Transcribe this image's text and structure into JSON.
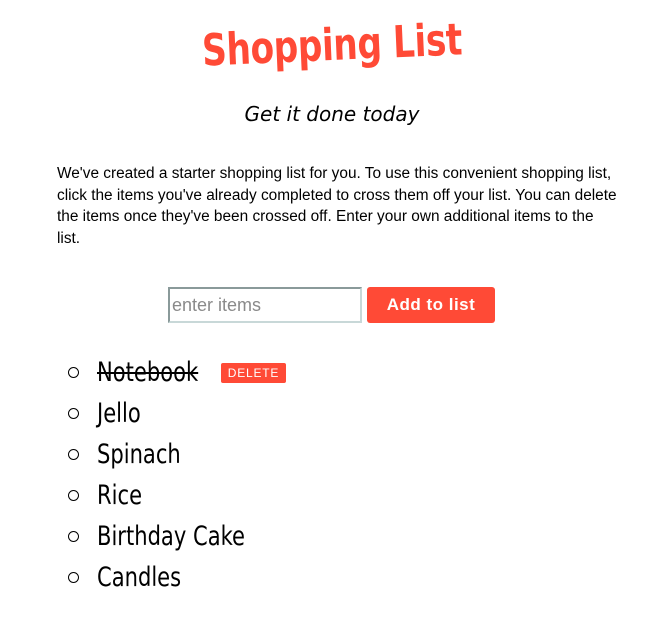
{
  "header": {
    "title": "Shopping List",
    "subtitle": "Get it done today"
  },
  "intro": {
    "text": "We've created a starter shopping list for you. To use this convenient shopping list, click the items you've already completed to cross them off your list. You can delete the items once they've been crossed off. Enter your own additional items to the list."
  },
  "form": {
    "input_placeholder": "enter items",
    "input_value": "",
    "add_label": "Add to list"
  },
  "items": [
    {
      "label": "Notebook",
      "done": true,
      "delete_label": "DELETE"
    },
    {
      "label": "Jello",
      "done": false
    },
    {
      "label": "Spinach",
      "done": false
    },
    {
      "label": "Rice",
      "done": false
    },
    {
      "label": "Birthday Cake",
      "done": false
    },
    {
      "label": "Candles",
      "done": false
    }
  ],
  "colors": {
    "accent": "#ff4a36",
    "text": "#000000",
    "background": "#ffffff"
  }
}
